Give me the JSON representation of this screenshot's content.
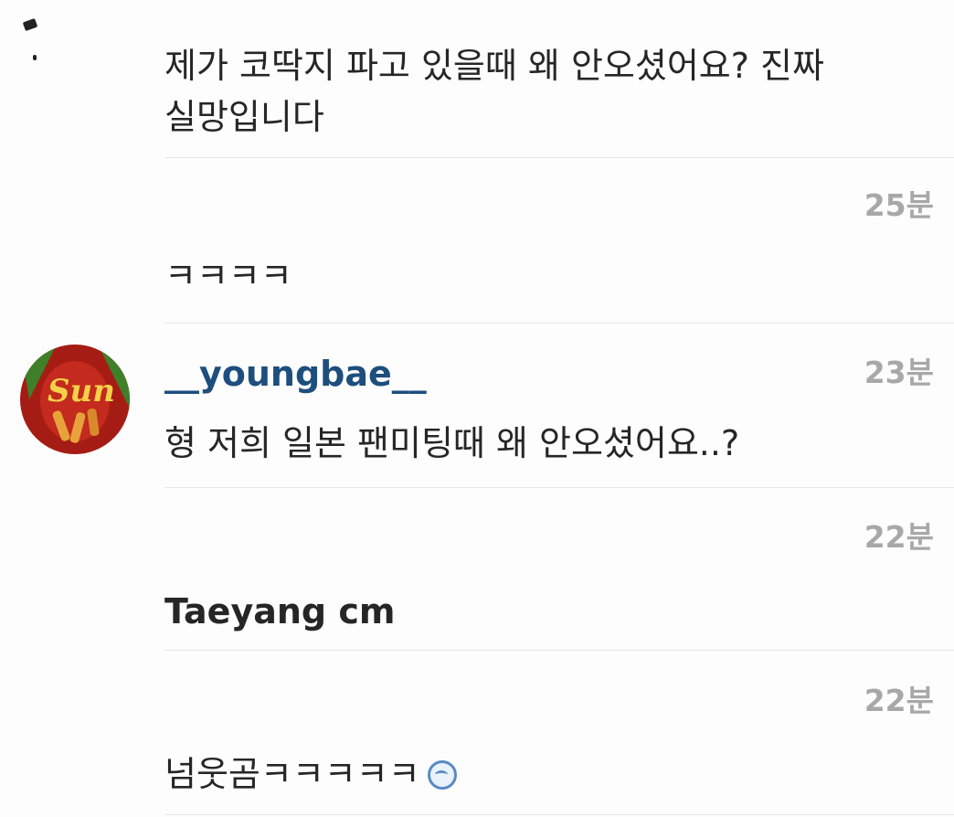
{
  "comments": [
    {
      "text_line1": "제가 코딱지 파고 있을때 왜 안오셨어요? 진짜",
      "text_line2": "실망입니다"
    },
    {
      "time": "25분",
      "text": "ㅋㅋㅋㅋ"
    },
    {
      "time": "23분",
      "username": "__youngbae__",
      "text": "형 저희 일본 팬미팅때 왜 안오셨어요..?",
      "avatar": {
        "label": "Sun",
        "colors": {
          "background": "#a51c14",
          "text": "#f3d24a",
          "leaf": "#3f7f2a"
        }
      }
    },
    {
      "time": "22분",
      "text": "Taeyang cm"
    },
    {
      "time": "22분",
      "text": "넘웃곰ㅋㅋㅋㅋㅋ",
      "emoji_icon": "smiling-face-icon"
    }
  ],
  "colors": {
    "username": "#1d4e7e",
    "timestamp": "#a8a8a8",
    "body_text": "#262626",
    "divider": "#e6e6e6"
  }
}
